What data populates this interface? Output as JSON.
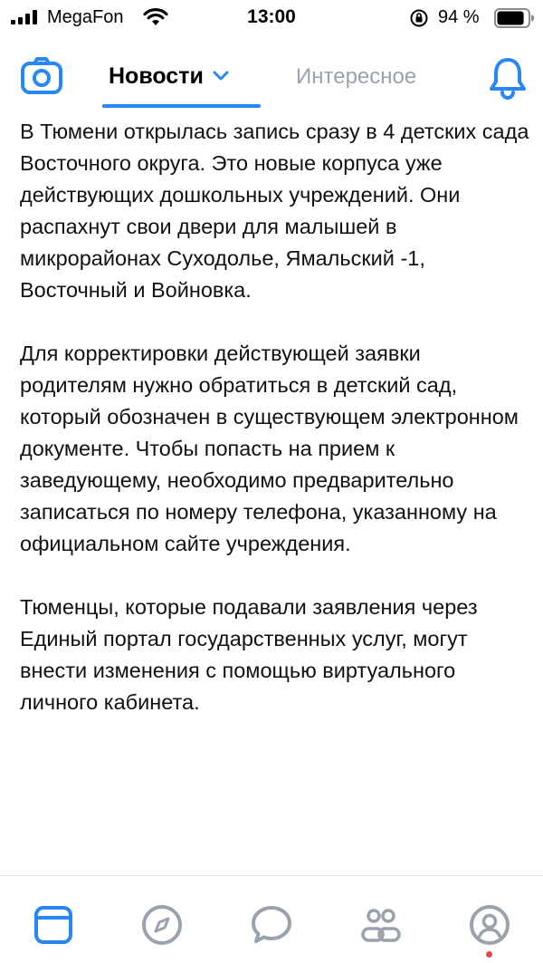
{
  "status_bar": {
    "carrier": "MegaFon",
    "time": "13:00",
    "battery_percent": "94 %",
    "battery_level": 0.94
  },
  "nav": {
    "left_icon": "camera-icon",
    "tab_active": "Новости",
    "tab_inactive": "Интересное",
    "right_icon": "bell-icon",
    "accent_color": "#2787f5",
    "inactive_color": "#99a2ad"
  },
  "post": {
    "paragraphs": [
      "В Тюмени открылась запись сразу в 4 детских сада Восточного округа. Это новые корпуса уже действующих дошкольных учреждений. Они распахнут свои двери для малышей в микрорайонах Суходолье, Ямальский -1, Восточный и Войновка.",
      "Для корректировки действующей заявки родителям нужно обратиться в детский сад, который обозначен в существующем электронном документе. Чтобы попасть на прием к заведующему, необходимо предварительно записаться по номеру телефона, указанному на официальном сайте учреждения.",
      "Тюменцы, которые подавали заявления через Единый портал государственных услуг, могут внести изменения с помощью виртуального личного кабинета."
    ]
  },
  "tab_bar": {
    "items": [
      {
        "icon": "news-icon",
        "active": true
      },
      {
        "icon": "compass-icon",
        "active": false
      },
      {
        "icon": "messages-icon",
        "active": false
      },
      {
        "icon": "friends-icon",
        "active": false
      },
      {
        "icon": "profile-icon",
        "active": false,
        "has_notification": true
      }
    ],
    "active_color": "#2787f5",
    "inactive_color": "#99a2ad",
    "notification_color": "#e64646"
  }
}
